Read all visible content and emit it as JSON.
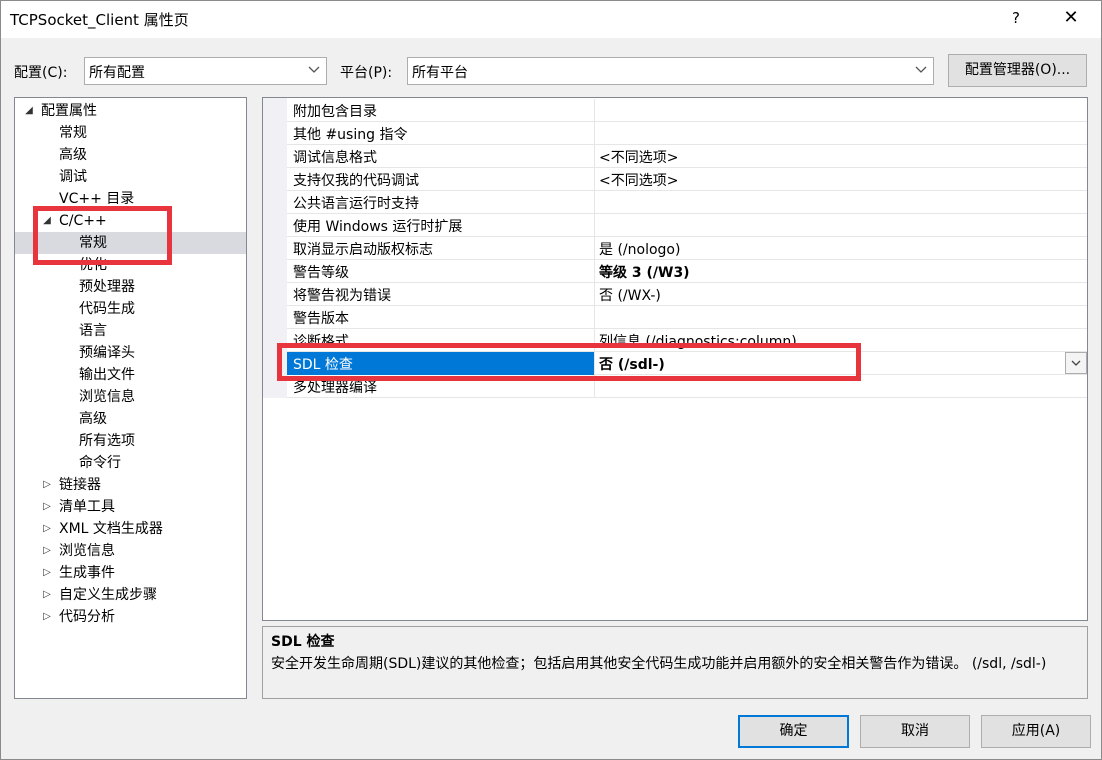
{
  "window": {
    "title": "TCPSocket_Client 属性页",
    "help_glyph": "?",
    "close_glyph": "✕"
  },
  "config_bar": {
    "config_label": "配置(C):",
    "config_value": "所有配置",
    "platform_label": "平台(P):",
    "platform_value": "所有平台",
    "manager_button": "配置管理器(O)..."
  },
  "tree": {
    "items": [
      {
        "label": "配置属性",
        "level": 0,
        "arrow": "expanded"
      },
      {
        "label": "常规",
        "level": 1
      },
      {
        "label": "高级",
        "level": 1
      },
      {
        "label": "调试",
        "level": 1
      },
      {
        "label": "VC++ 目录",
        "level": 1
      },
      {
        "label": "C/C++",
        "level": 1,
        "arrow": "expanded"
      },
      {
        "label": "常规",
        "level": 2,
        "selected": true
      },
      {
        "label": "优化",
        "level": 2
      },
      {
        "label": "预处理器",
        "level": 2
      },
      {
        "label": "代码生成",
        "level": 2
      },
      {
        "label": "语言",
        "level": 2
      },
      {
        "label": "预编译头",
        "level": 2
      },
      {
        "label": "输出文件",
        "level": 2
      },
      {
        "label": "浏览信息",
        "level": 2
      },
      {
        "label": "高级",
        "level": 2
      },
      {
        "label": "所有选项",
        "level": 2
      },
      {
        "label": "命令行",
        "level": 2
      },
      {
        "label": "链接器",
        "level": 1,
        "arrow": "collapsed"
      },
      {
        "label": "清单工具",
        "level": 1,
        "arrow": "collapsed"
      },
      {
        "label": "XML 文档生成器",
        "level": 1,
        "arrow": "collapsed"
      },
      {
        "label": "浏览信息",
        "level": 1,
        "arrow": "collapsed"
      },
      {
        "label": "生成事件",
        "level": 1,
        "arrow": "collapsed"
      },
      {
        "label": "自定义生成步骤",
        "level": 1,
        "arrow": "collapsed"
      },
      {
        "label": "代码分析",
        "level": 1,
        "arrow": "collapsed"
      }
    ]
  },
  "properties": {
    "rows": [
      {
        "name": "附加包含目录",
        "value": ""
      },
      {
        "name": "其他 #using 指令",
        "value": ""
      },
      {
        "name": "调试信息格式",
        "value": "<不同选项>"
      },
      {
        "name": "支持仅我的代码调试",
        "value": "<不同选项>"
      },
      {
        "name": "公共语言运行时支持",
        "value": ""
      },
      {
        "name": "使用 Windows 运行时扩展",
        "value": ""
      },
      {
        "name": "取消显示启动版权标志",
        "value": "是 (/nologo)"
      },
      {
        "name": "警告等级",
        "value": "等级 3 (/W3)",
        "bold": true
      },
      {
        "name": "将警告视为错误",
        "value": "否 (/WX-)"
      },
      {
        "name": "警告版本",
        "value": ""
      },
      {
        "name": "诊断格式",
        "value": "列信息 (/diagnostics:column)"
      },
      {
        "name": "SDL 检查",
        "value": "否 (/sdl-)",
        "bold": true,
        "selected": true
      },
      {
        "name": "多处理器编译",
        "value": ""
      }
    ]
  },
  "description": {
    "title": "SDL 检查",
    "text": "安全开发生命周期(SDL)建议的其他检查；包括启用其他安全代码生成功能并启用额外的安全相关警告作为错误。      (/sdl, /sdl-)"
  },
  "buttons": {
    "ok": "确定",
    "cancel": "取消",
    "apply": "应用(A)"
  },
  "colors": {
    "selection_blue": "#0078d7",
    "annotation_red": "#e8343c"
  }
}
